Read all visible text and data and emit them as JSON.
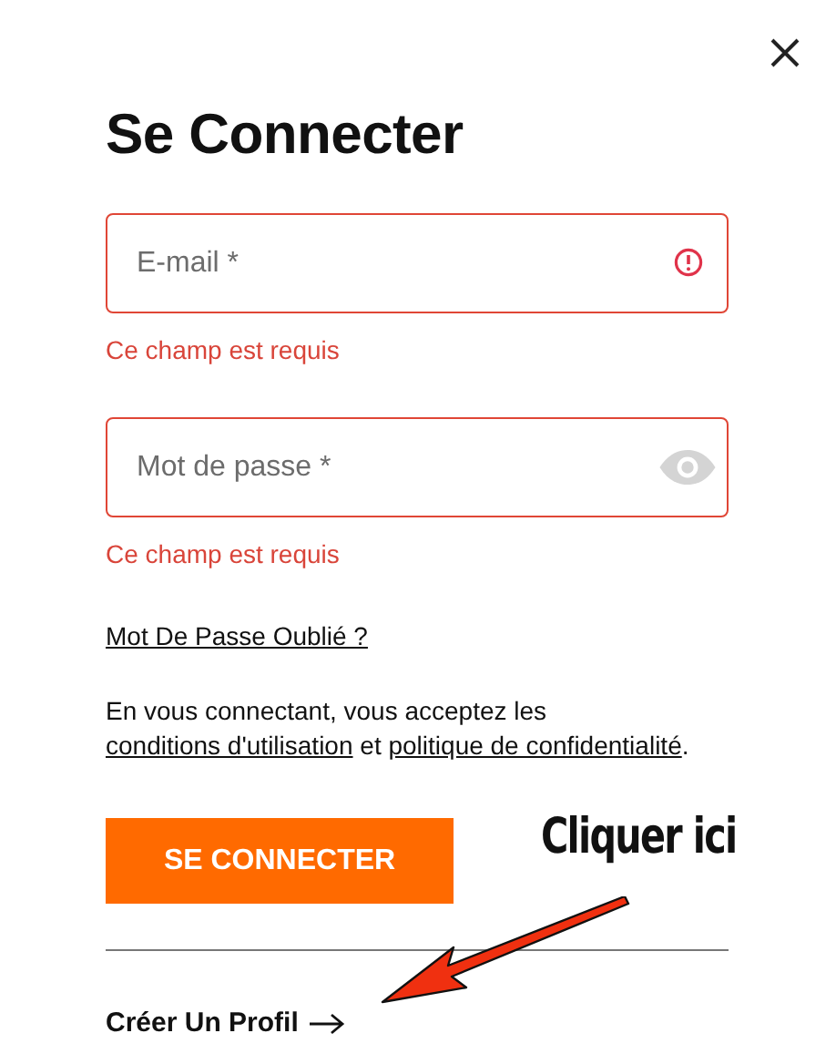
{
  "title": "Se Connecter",
  "fields": [
    {
      "kind": "email",
      "placeholder": "E-mail *",
      "invalid": true,
      "error": "Ce champ est requis"
    },
    {
      "kind": "password",
      "placeholder": "Mot de passe *",
      "invalid": true,
      "error": "Ce champ est requis"
    }
  ],
  "forgot_link": "Mot De Passe Oublié ?",
  "terms": [
    {
      "kind": "text",
      "text": "En vous connectant, vous acceptez les "
    },
    {
      "kind": "link",
      "text": "conditions d'utilisation"
    },
    {
      "kind": "text",
      "text": " et "
    },
    {
      "kind": "link",
      "text": "politique de confidentialité"
    },
    {
      "kind": "text",
      "text": "."
    }
  ],
  "submit_button": "SE CONNECTER",
  "create_profile_link": "Créer Un Profil",
  "annotation": {
    "text": "Cliquer ici"
  }
}
